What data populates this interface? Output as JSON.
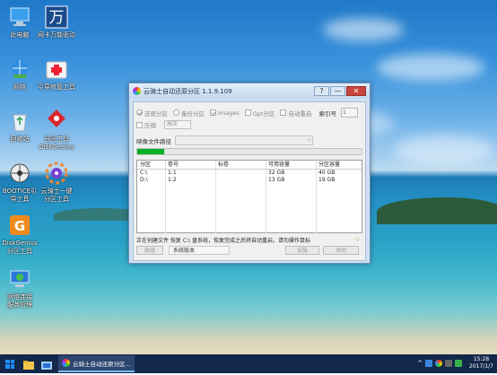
{
  "desktop": {
    "icons": [
      {
        "label": "此电脑",
        "icon": "computer-icon"
      },
      {
        "label": "网卡万能驱动",
        "icon": "wan-icon"
      },
      {
        "label": "网络",
        "icon": "network-icon"
      },
      {
        "label": "引导修复工具",
        "icon": "medkit-icon"
      },
      {
        "label": "回收站",
        "icon": "recycle-bin-icon"
      },
      {
        "label": "分区工具\nDiskGenius",
        "icon": "diskgenius-icon"
      },
      {
        "label": "BOOTICE引\n导工具",
        "icon": "bootice-icon"
      },
      {
        "label": "云骑士一键\n分区工具",
        "icon": "yunqishi-partition-icon"
      },
      {
        "label": "DiskGenius\n分区工具",
        "icon": "diskgenius-orange-icon"
      },
      {
        "label": "网络连接\n服务管理",
        "icon": "network-service-icon"
      }
    ]
  },
  "window": {
    "title": "云骑士自动还原分区 1.1.9.109",
    "buttons": {
      "help": "?",
      "minimize": "—",
      "close": "✕"
    },
    "options": {
      "restore": "还原分区",
      "backup": "备份分区",
      "images": "Images",
      "gpt": "Gpt分区",
      "auto_restart": "自动重启",
      "index_label": "索引号",
      "index_value": "1",
      "compress": "压缩",
      "compress_value": "高压"
    },
    "image_path_label": "映像文件路径",
    "progress": 0.12,
    "table": {
      "headers": [
        "分区",
        "卷号",
        "标卷",
        "可用容量",
        "分区容量"
      ],
      "rows": [
        [
          "C:\\",
          "1:1",
          "",
          "32 GB",
          "40 GB"
        ],
        [
          "D:\\",
          "1:2",
          "",
          "13 GB",
          "19 GB"
        ]
      ]
    },
    "status": "正在创建文件   恢复 C:\\ 盘系统，恢复完成之后将自动重启，请勿操作鼠标",
    "buttons_bottom": {
      "advanced": "高级",
      "version": "系统版本",
      "install": "安装",
      "close": "关闭"
    }
  },
  "taskbar": {
    "app_label": "云骑士自动还原分区...",
    "time": "15:28",
    "date": "2017/1/7"
  },
  "colors": {
    "taskbar": "#13284a",
    "progress": "#06b025",
    "close_button": "#c9443a"
  }
}
